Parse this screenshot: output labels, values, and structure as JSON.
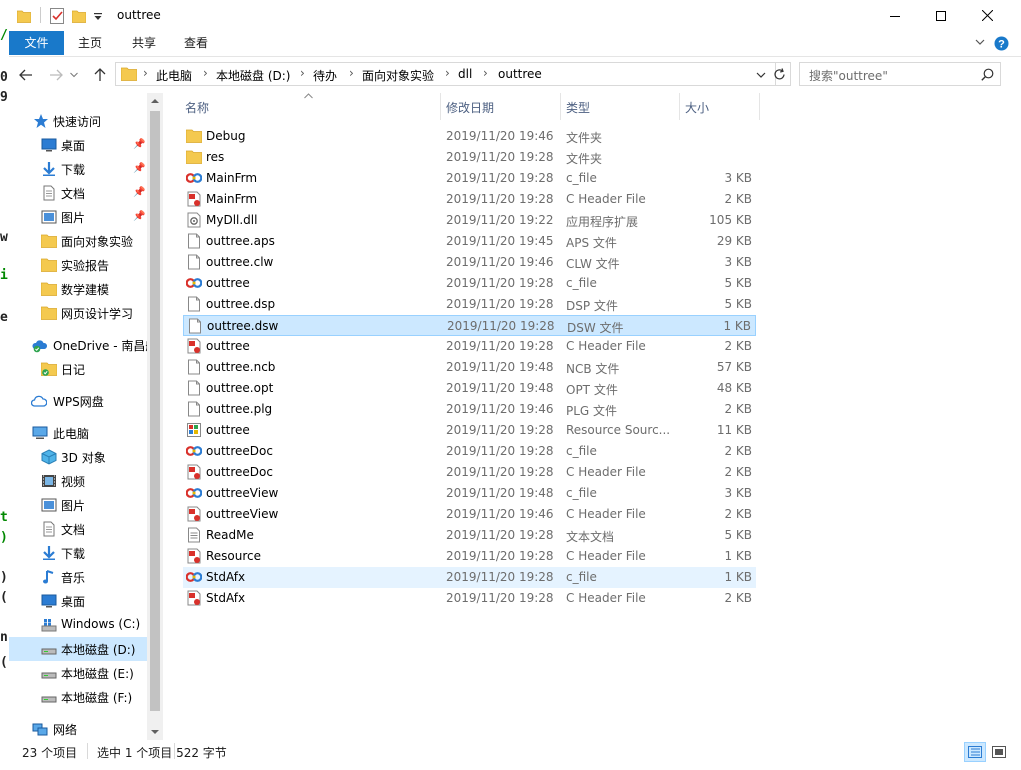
{
  "window": {
    "title": "outtree",
    "controls": {
      "minimize": "—",
      "maximize": "☐",
      "close": "✕"
    }
  },
  "ribbon": {
    "tabs": [
      "文件",
      "主页",
      "共享",
      "查看"
    ],
    "collapse_icon": "chevron-down-icon",
    "help_icon": "help-icon"
  },
  "address": {
    "crumbs": [
      "此电脑",
      "本地磁盘 (D:)",
      "待办",
      "面向对象实验",
      "dll",
      "outtree"
    ],
    "search_placeholder": "搜索\"outtree\""
  },
  "nav": {
    "quick_access": {
      "label": "快速访问",
      "items": [
        "桌面",
        "下载",
        "文档",
        "图片",
        "面向对象实验",
        "实验报告",
        "数学建模",
        "网页设计学习"
      ]
    },
    "onedrive": {
      "label": "OneDrive - 南昌航",
      "items": [
        "日记"
      ]
    },
    "wps": {
      "label": "WPS网盘"
    },
    "this_pc": {
      "label": "此电脑",
      "items": [
        "3D 对象",
        "视频",
        "图片",
        "文档",
        "下载",
        "音乐",
        "桌面",
        "Windows (C:)",
        "本地磁盘 (D:)",
        "本地磁盘 (E:)",
        "本地磁盘 (F:)"
      ]
    },
    "network": {
      "label": "网络"
    }
  },
  "columns": {
    "name": "名称",
    "date": "修改日期",
    "type": "类型",
    "size": "大小"
  },
  "files": [
    {
      "name": "Debug",
      "date": "2019/11/20 19:46",
      "type": "文件夹",
      "size": "",
      "icon": "folder"
    },
    {
      "name": "res",
      "date": "2019/11/20 19:28",
      "type": "文件夹",
      "size": "",
      "icon": "folder"
    },
    {
      "name": "MainFrm",
      "date": "2019/11/20 19:28",
      "type": "c_file",
      "size": "3 KB",
      "icon": "cfile"
    },
    {
      "name": "MainFrm",
      "date": "2019/11/20 19:28",
      "type": "C Header File",
      "size": "2 KB",
      "icon": "hfile"
    },
    {
      "name": "MyDll.dll",
      "date": "2019/11/20 19:22",
      "type": "应用程序扩展",
      "size": "105 KB",
      "icon": "dll"
    },
    {
      "name": "outtree.aps",
      "date": "2019/11/20 19:45",
      "type": "APS 文件",
      "size": "29 KB",
      "icon": "doc"
    },
    {
      "name": "outtree.clw",
      "date": "2019/11/20 19:46",
      "type": "CLW 文件",
      "size": "3 KB",
      "icon": "doc"
    },
    {
      "name": "outtree",
      "date": "2019/11/20 19:28",
      "type": "c_file",
      "size": "5 KB",
      "icon": "cfile"
    },
    {
      "name": "outtree.dsp",
      "date": "2019/11/20 19:28",
      "type": "DSP 文件",
      "size": "5 KB",
      "icon": "doc"
    },
    {
      "name": "outtree.dsw",
      "date": "2019/11/20 19:28",
      "type": "DSW 文件",
      "size": "1 KB",
      "icon": "doc",
      "selected": true
    },
    {
      "name": "outtree",
      "date": "2019/11/20 19:28",
      "type": "C Header File",
      "size": "2 KB",
      "icon": "hfile"
    },
    {
      "name": "outtree.ncb",
      "date": "2019/11/20 19:48",
      "type": "NCB 文件",
      "size": "57 KB",
      "icon": "doc"
    },
    {
      "name": "outtree.opt",
      "date": "2019/11/20 19:48",
      "type": "OPT 文件",
      "size": "48 KB",
      "icon": "doc"
    },
    {
      "name": "outtree.plg",
      "date": "2019/11/20 19:46",
      "type": "PLG 文件",
      "size": "2 KB",
      "icon": "doc"
    },
    {
      "name": "outtree",
      "date": "2019/11/20 19:28",
      "type": "Resource Sourc...",
      "size": "11 KB",
      "icon": "rc"
    },
    {
      "name": "outtreeDoc",
      "date": "2019/11/20 19:28",
      "type": "c_file",
      "size": "2 KB",
      "icon": "cfile"
    },
    {
      "name": "outtreeDoc",
      "date": "2019/11/20 19:28",
      "type": "C Header File",
      "size": "2 KB",
      "icon": "hfile"
    },
    {
      "name": "outtreeView",
      "date": "2019/11/20 19:48",
      "type": "c_file",
      "size": "3 KB",
      "icon": "cfile"
    },
    {
      "name": "outtreeView",
      "date": "2019/11/20 19:46",
      "type": "C Header File",
      "size": "2 KB",
      "icon": "hfile"
    },
    {
      "name": "ReadMe",
      "date": "2019/11/20 19:28",
      "type": "文本文档",
      "size": "5 KB",
      "icon": "txt"
    },
    {
      "name": "Resource",
      "date": "2019/11/20 19:28",
      "type": "C Header File",
      "size": "1 KB",
      "icon": "hfile"
    },
    {
      "name": "StdAfx",
      "date": "2019/11/20 19:28",
      "type": "c_file",
      "size": "1 KB",
      "icon": "cfile",
      "hover": true
    },
    {
      "name": "StdAfx",
      "date": "2019/11/20 19:28",
      "type": "C Header File",
      "size": "2 KB",
      "icon": "hfile"
    }
  ],
  "status": {
    "count": "23 个项目",
    "selection": "选中 1 个项目  522 字节"
  },
  "colors": {
    "accent": "#1979ca",
    "selection": "#cce8ff",
    "folder": "#f4c94f"
  }
}
